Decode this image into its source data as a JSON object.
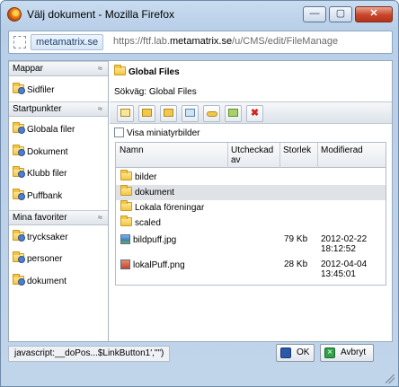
{
  "window": {
    "title": "Välj dokument - Mozilla Firefox",
    "minimize_glyph": "—",
    "maximize_glyph": "▢",
    "close_glyph": "✕"
  },
  "address_bar": {
    "site_badge": "metamatrix.se",
    "url_prefix": "https://ftf.lab.",
    "url_host": "metamatrix.se",
    "url_suffix": "/u/CMS/edit/FileManage"
  },
  "sidebar": {
    "sections": [
      {
        "title": "Mappar",
        "items": [
          "Sidfiler"
        ]
      },
      {
        "title": "Startpunkter",
        "items": [
          "Globala filer",
          "Dokument",
          "Klubb filer",
          "Puffbank"
        ]
      },
      {
        "title": "Mina favoriter",
        "items": [
          "trycksaker",
          "personer",
          "dokument"
        ]
      }
    ],
    "collapse_glyph": "≈"
  },
  "main": {
    "folder_title": "Global Files",
    "path": "Sökväg: Global Files",
    "toolbar_icons": [
      "new-folder-icon",
      "upload-icon",
      "copy-icon",
      "refresh-icon",
      "key-icon",
      "edit-icon",
      "delete-icon"
    ],
    "show_thumbnails_label": "Visa miniatyrbilder",
    "columns": {
      "name": "Namn",
      "checked_out_1": "Utcheckad",
      "checked_out_2": "av",
      "size": "Storlek",
      "modified": "Modifierad"
    },
    "folders": [
      "bilder",
      "dokument",
      "Lokala föreningar",
      "scaled"
    ],
    "selected_folder": "dokument",
    "files": [
      {
        "name": "bildpuff.jpg",
        "size": "79 Kb",
        "date": "2012-02-22",
        "time": "18:12:52",
        "icon": "jpg-file-icon"
      },
      {
        "name": "lokalPuff.png",
        "size": "28 Kb",
        "date": "2012-04-04",
        "time": "13:45:01",
        "icon": "png-file-icon"
      }
    ]
  },
  "status_bar": {
    "text": "javascript:__doPos...$LinkButton1',\"\")",
    "ok_label": "OK",
    "cancel_label": "Avbryt"
  }
}
